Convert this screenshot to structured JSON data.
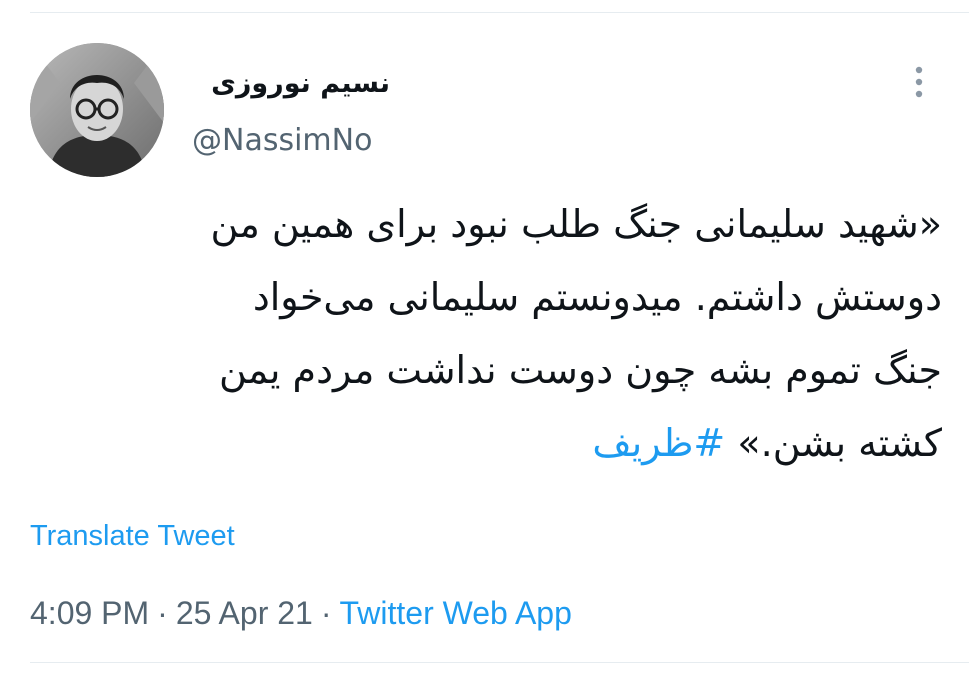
{
  "tweet": {
    "author": {
      "display_name": "نسیم نوروزی",
      "handle": "@NassimNo"
    },
    "text_lines": [
      "«شهید سلیمانی جنگ طلب نبود برای همین من",
      "دوستش داشتم. میدونستم سلیمانی می‌خواد",
      "جنگ تموم بشه چون دوست نداشت مردم یمن"
    ],
    "last_line_text": "کشته بشن.» ",
    "hashtag": "#ظریف",
    "translate_label": "Translate Tweet",
    "time": "4:09 PM",
    "separator": "·",
    "date": "25 Apr 21",
    "source": "Twitter Web App"
  },
  "icons": {
    "more": "more-vertical-icon",
    "avatar": "avatar"
  },
  "colors": {
    "link": "#1d9bf0",
    "secondary_text": "#536471",
    "primary_text": "#0f1419",
    "divider": "#e6ecf0"
  }
}
